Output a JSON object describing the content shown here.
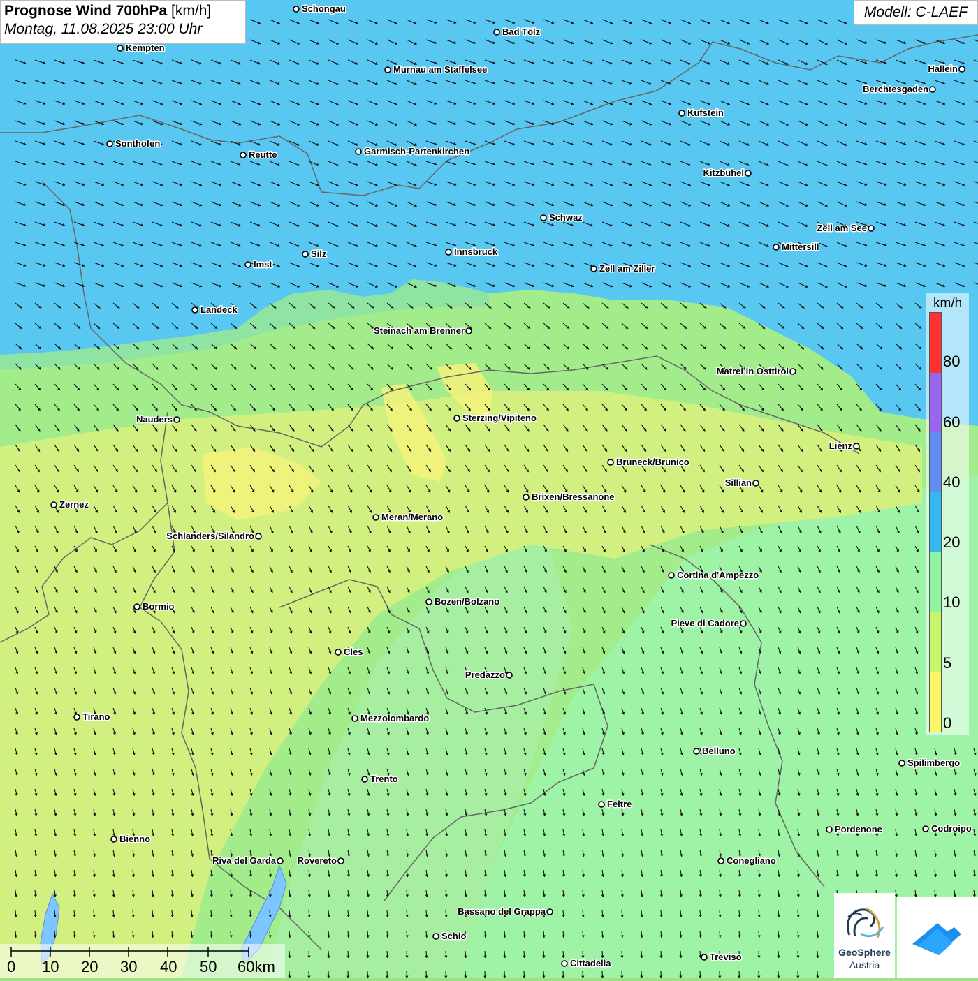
{
  "title": {
    "bold": "Prognose Wind 700hPa",
    "unit": "[km/h]",
    "date": "Montag, 11.08.2025 23:00 Uhr"
  },
  "model": "Modell: C-LAEF",
  "legend": {
    "unit": "km/h",
    "labels": [
      "80",
      "60",
      "40",
      "20",
      "10",
      "5",
      "0"
    ],
    "colors": [
      "#ff3030",
      "#9966ee",
      "#5f8ff2",
      "#33b8f0",
      "#8ff39f",
      "#c8f46a",
      "#fdf666"
    ]
  },
  "scale": {
    "labels": [
      "0",
      "10",
      "20",
      "30",
      "40",
      "50",
      "60km"
    ]
  },
  "logo": {
    "line1": "GeoSphere",
    "line2": "Austria"
  },
  "colors": {
    "band_north": "#58c8f2",
    "band_mid": "#98eb8c",
    "band_yellow": "#d6f27d",
    "band_south_green": "#9ef3a6",
    "arrow": "#111111",
    "border": "#666666"
  },
  "cities": [
    {
      "name": "Schongau"
    },
    {
      "name": "Bad Tölz"
    },
    {
      "name": "Kempten"
    },
    {
      "name": "Murnau am Staffelsee"
    },
    {
      "name": "Hallein"
    },
    {
      "name": "Berchtesgaden"
    },
    {
      "name": "Kufstein"
    },
    {
      "name": "Sonthofen"
    },
    {
      "name": "Reutte"
    },
    {
      "name": "Garmisch-Partenkirchen"
    },
    {
      "name": "Kitzbühel"
    },
    {
      "name": "Schwaz"
    },
    {
      "name": "Zell am See"
    },
    {
      "name": "Mittersill"
    },
    {
      "name": "Innsbruck"
    },
    {
      "name": "Silz"
    },
    {
      "name": "Imst"
    },
    {
      "name": "Zell am Ziller"
    },
    {
      "name": "Landeck"
    },
    {
      "name": "Steinach am Brenner"
    },
    {
      "name": "Matrei in Osttirol"
    },
    {
      "name": "Nauders"
    },
    {
      "name": "Sterzing/Vipiteno"
    },
    {
      "name": "Lienz"
    },
    {
      "name": "Bruneck/Brunico"
    },
    {
      "name": "Sillian"
    },
    {
      "name": "Zernez"
    },
    {
      "name": "Brixen/Bressanone"
    },
    {
      "name": "Meran/Merano"
    },
    {
      "name": "Schlanders/Silandro"
    },
    {
      "name": "Cortina d'Ampezzo"
    },
    {
      "name": "Bozen/Bolzano"
    },
    {
      "name": "Bormio"
    },
    {
      "name": "Pieve di Cadore"
    },
    {
      "name": "Cles"
    },
    {
      "name": "Predazzo"
    },
    {
      "name": "Tirano"
    },
    {
      "name": "Mezzolombardo"
    },
    {
      "name": "Belluno"
    },
    {
      "name": "Spilimbergo"
    },
    {
      "name": "Trento"
    },
    {
      "name": "Feltre"
    },
    {
      "name": "Pordenone"
    },
    {
      "name": "Codroipo"
    },
    {
      "name": "Bienno"
    },
    {
      "name": "Riva del Garda"
    },
    {
      "name": "Rovereto"
    },
    {
      "name": "Conegliano"
    },
    {
      "name": "Bassano del Grappa"
    },
    {
      "name": "Schio"
    },
    {
      "name": "Treviso"
    },
    {
      "name": "Cittadella"
    }
  ]
}
